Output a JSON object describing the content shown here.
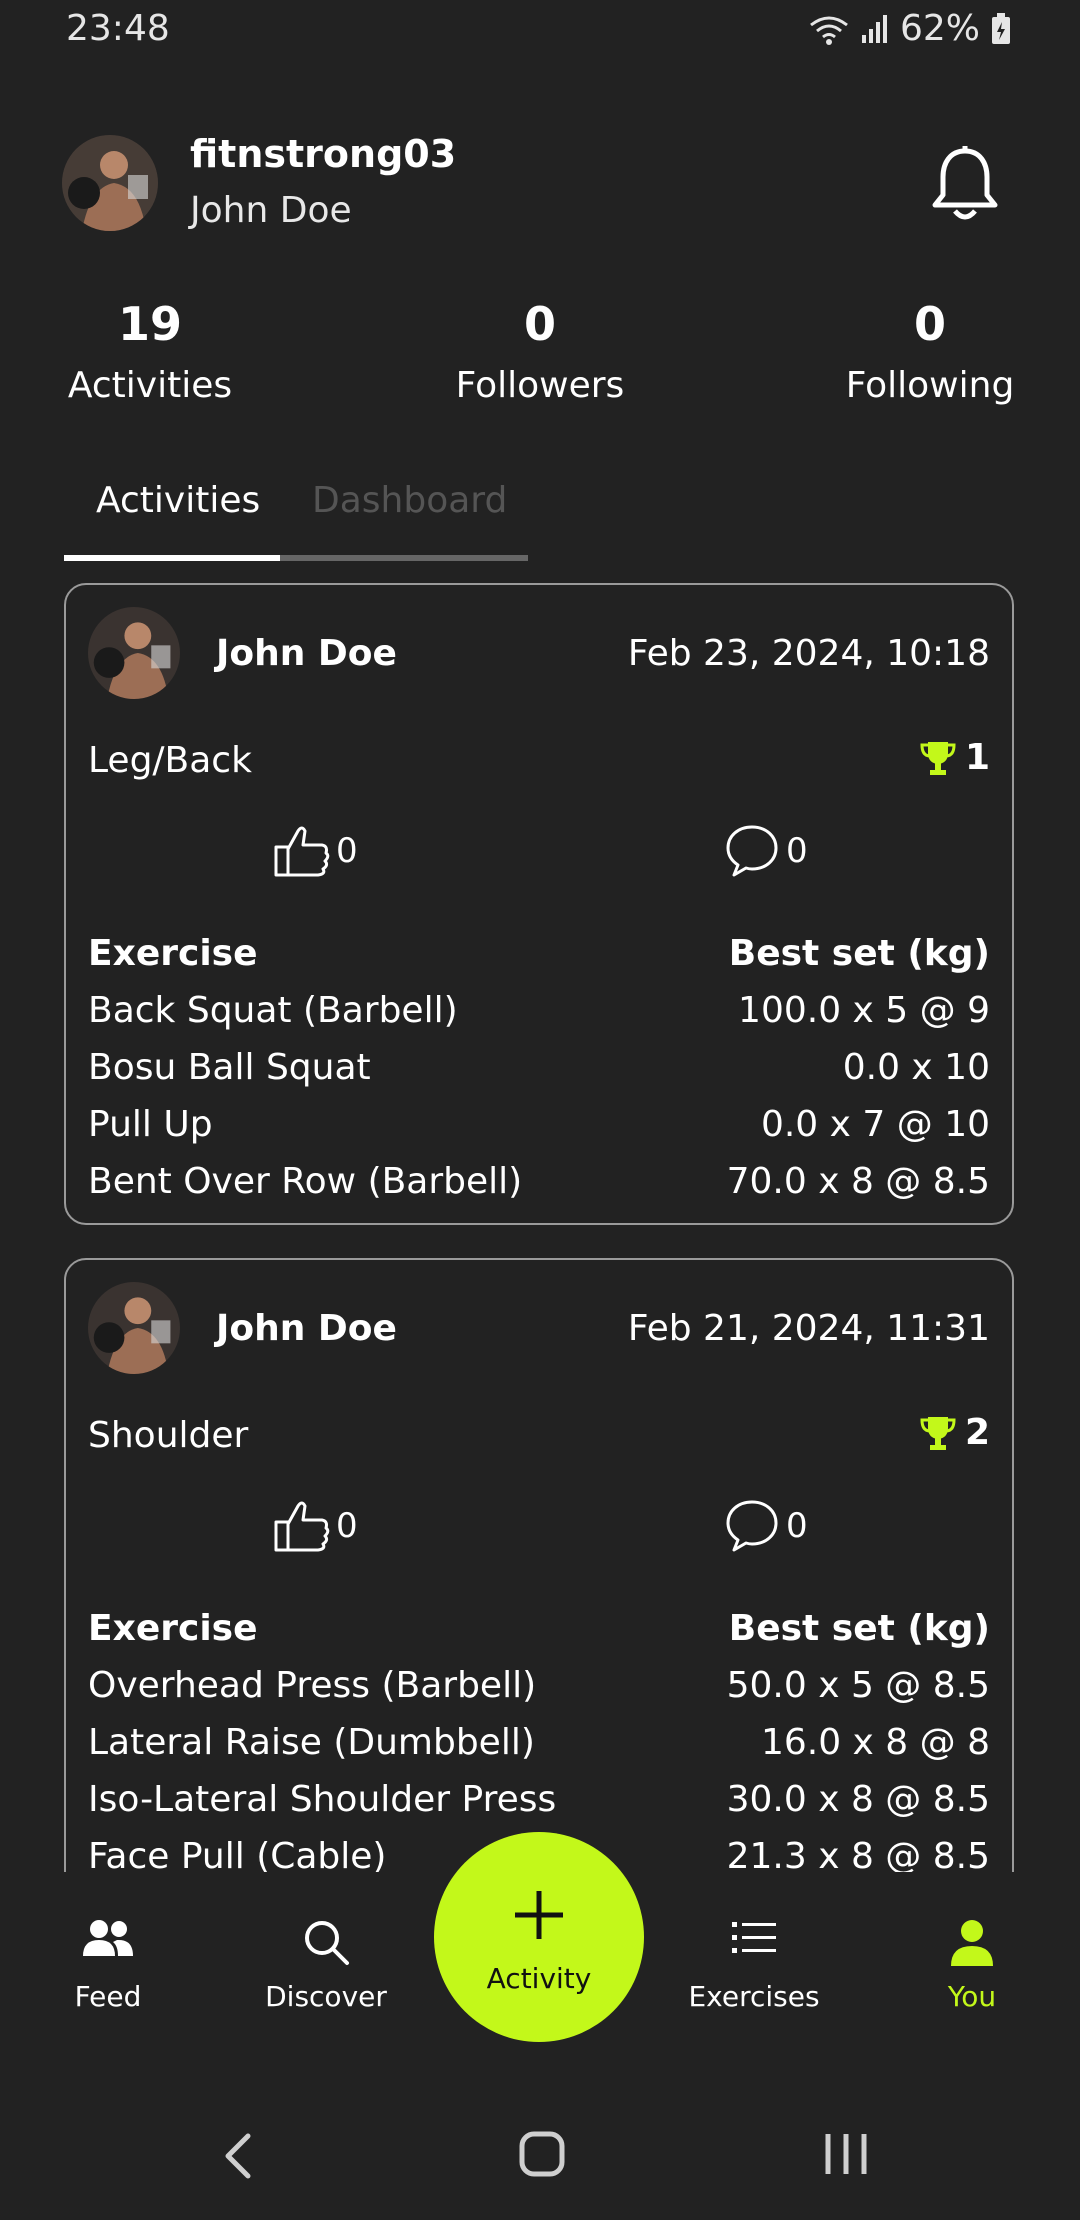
{
  "status": {
    "time": "23:48",
    "battery": "62%"
  },
  "profile": {
    "username": "fitnstrong03",
    "name": "John Doe"
  },
  "stats": [
    {
      "value": "19",
      "label": "Activities"
    },
    {
      "value": "0",
      "label": "Followers"
    },
    {
      "value": "0",
      "label": "Following"
    }
  ],
  "tabs": {
    "active": "Activities",
    "inactive": "Dashboard"
  },
  "cards": [
    {
      "name": "John Doe",
      "date": "Feb 23, 2024, 10:18",
      "title": "Leg/Back",
      "trophies": "1",
      "likes": "0",
      "comments": "0",
      "header": {
        "exercise": "Exercise",
        "best": "Best set (kg)"
      },
      "rows": [
        {
          "exercise": "Back Squat (Barbell)",
          "best": "100.0 x 5 @ 9"
        },
        {
          "exercise": "Bosu Ball Squat",
          "best": "0.0 x 10"
        },
        {
          "exercise": "Pull Up",
          "best": "0.0 x 7 @ 10"
        },
        {
          "exercise": "Bent Over Row (Barbell)",
          "best": "70.0 x 8 @ 8.5"
        }
      ]
    },
    {
      "name": "John Doe",
      "date": "Feb 21, 2024, 11:31",
      "title": "Shoulder",
      "trophies": "2",
      "likes": "0",
      "comments": "0",
      "header": {
        "exercise": "Exercise",
        "best": "Best set (kg)"
      },
      "rows": [
        {
          "exercise": "Overhead Press (Barbell)",
          "best": "50.0 x 5 @ 8.5"
        },
        {
          "exercise": "Lateral Raise (Dumbbell)",
          "best": "16.0 x 8 @ 8"
        },
        {
          "exercise": "Iso-Lateral Shoulder Press",
          "best": "30.0 x 8 @ 8.5"
        },
        {
          "exercise": "Face Pull (Cable)",
          "best": "21.3 x 8 @ 8.5"
        }
      ]
    }
  ],
  "nav": {
    "feed": "Feed",
    "discover": "Discover",
    "activity": "Activity",
    "exercises": "Exercises",
    "you": "You"
  },
  "colors": {
    "accent": "#c3f81a",
    "background": "#222222",
    "border": "#9a9a9a"
  }
}
